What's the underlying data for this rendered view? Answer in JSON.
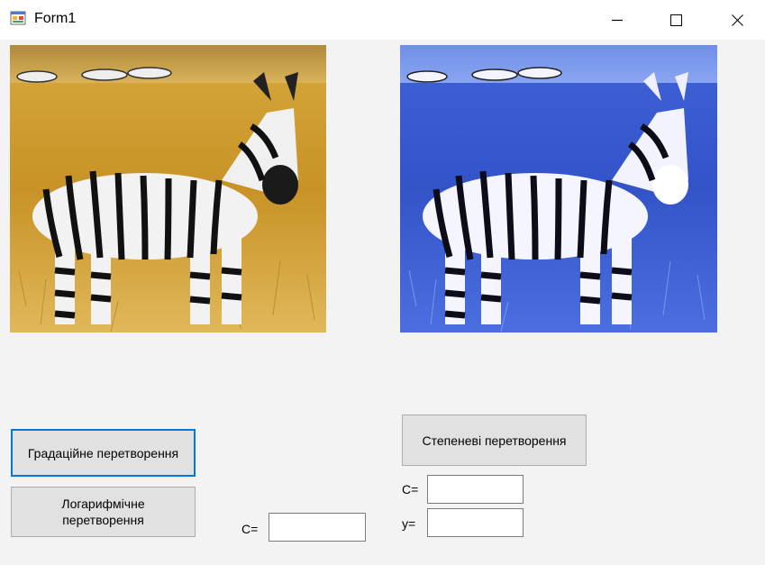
{
  "window": {
    "title": "Form1",
    "icon": "winforms-form-icon",
    "controls": [
      "minimize-icon",
      "maximize-icon",
      "close-icon"
    ]
  },
  "pictures": {
    "original": {
      "subject": "zebra-photo",
      "tint": "#c8a040"
    },
    "processed": {
      "subject": "zebra-photo",
      "tint": "#3c5fd8"
    }
  },
  "buttons": {
    "gradation": "Градаційне перетворення",
    "logarithmic": "Логарифмічне перетворення",
    "power": "Степеневі перетворення"
  },
  "log_params": {
    "c_label": "C=",
    "c_value": ""
  },
  "power_params": {
    "c_label": "C=",
    "c_value": "",
    "y_label": "y=",
    "y_value": ""
  },
  "colors": {
    "focus_border": "#0078d7",
    "button_face": "#e1e1e1",
    "form_background": "#f3f3f3"
  }
}
